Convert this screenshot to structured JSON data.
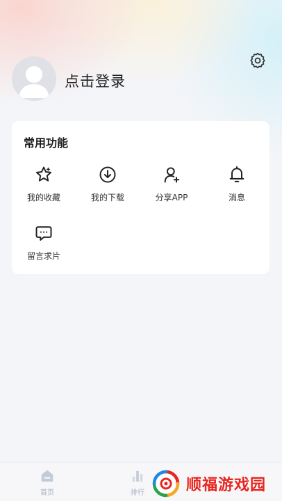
{
  "header": {
    "login_label": "点击登录"
  },
  "functions": {
    "title": "常用功能",
    "items": [
      {
        "label": "我的收藏",
        "icon": "star-icon"
      },
      {
        "label": "我的下载",
        "icon": "download-icon"
      },
      {
        "label": "分享APP",
        "icon": "share-user-icon"
      },
      {
        "label": "消息",
        "icon": "bell-icon"
      },
      {
        "label": "留言求片",
        "icon": "message-icon"
      }
    ]
  },
  "tabbar": {
    "tabs": [
      {
        "label": "首页",
        "icon": "home-icon"
      },
      {
        "label": "排行",
        "icon": "rank-icon"
      }
    ]
  },
  "watermark": {
    "text": "顺福游戏园"
  },
  "colors": {
    "accent": "#e8251f",
    "tab_inactive": "#a9b0c4"
  }
}
